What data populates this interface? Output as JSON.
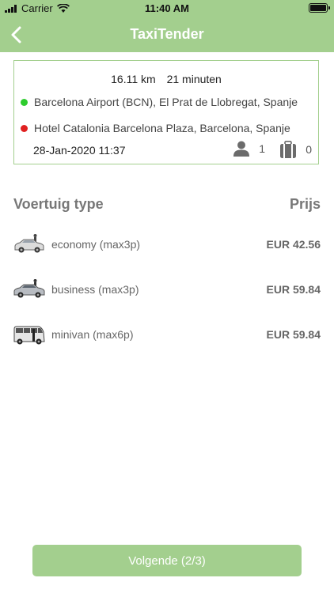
{
  "status_bar": {
    "carrier": "Carrier",
    "time": "11:40 AM"
  },
  "nav": {
    "title": "TaxiTender"
  },
  "route": {
    "distance": "16.11 km",
    "duration": "21 minuten",
    "from": "Barcelona Airport (BCN), El Prat de Llobregat, Spanje",
    "to": "Hotel Catalonia Barcelona Plaza, Barcelona, Spanje",
    "datetime": "28-Jan-2020 11:37",
    "passengers": "1",
    "luggage": "0",
    "from_color": "#2ecc2e",
    "to_color": "#e02020"
  },
  "table": {
    "type_header": "Voertuig type",
    "price_header": "Prijs"
  },
  "vehicles": [
    {
      "label": "economy (max3p)",
      "price": "EUR 42.56",
      "icon": "economy-car-icon"
    },
    {
      "label": "business (max3p)",
      "price": "EUR 59.84",
      "icon": "business-car-icon"
    },
    {
      "label": "minivan (max6p)",
      "price": "EUR 59.84",
      "icon": "minivan-icon"
    }
  ],
  "footer": {
    "next_label": "Volgende (2/3)"
  },
  "colors": {
    "accent": "#a3cf8e"
  }
}
